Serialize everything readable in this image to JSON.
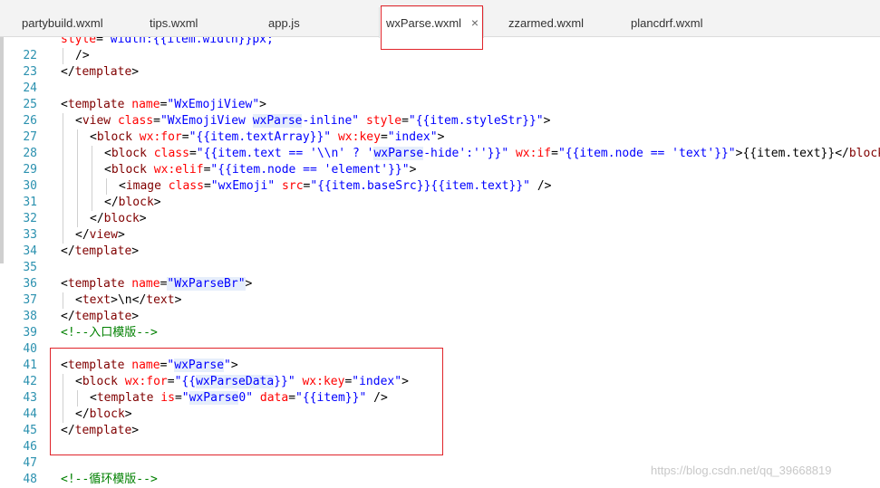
{
  "tabs": [
    {
      "label": "partybuild.wxml",
      "active": false
    },
    {
      "label": "tips.wxml",
      "active": false
    },
    {
      "label": "app.js",
      "active": false
    },
    {
      "label": "wxParse.wxml",
      "active": true,
      "close": "×"
    },
    {
      "label": "zzarmed.wxml",
      "active": false
    },
    {
      "label": "plancdrf.wxml",
      "active": false
    }
  ],
  "colors": {
    "highlight_box": "#e0242a",
    "line_number": "#2b91af",
    "tag": "#800000",
    "attribute": "#ff0000",
    "string": "#0000ff",
    "comment": "#008000"
  },
  "lines": [
    {
      "n": "",
      "indent": 0,
      "tokens": [
        [
          "attr",
          "style"
        ],
        [
          "br",
          "="
        ],
        [
          "str",
          "\"width:{{item.width}}px;\""
        ]
      ]
    },
    {
      "n": "22",
      "indent": 1,
      "tokens": [
        [
          "br",
          "/>"
        ]
      ]
    },
    {
      "n": "23",
      "indent": 0,
      "tokens": [
        [
          "br",
          "</"
        ],
        [
          "tag",
          "template"
        ],
        [
          "br",
          ">"
        ]
      ]
    },
    {
      "n": "24",
      "indent": 0,
      "tokens": []
    },
    {
      "n": "25",
      "indent": 0,
      "tokens": [
        [
          "br",
          "<"
        ],
        [
          "tag",
          "template"
        ],
        [
          "txt",
          " "
        ],
        [
          "attr",
          "name"
        ],
        [
          "br",
          "="
        ],
        [
          "str",
          "\"WxEmojiView\""
        ],
        [
          "br",
          ">"
        ]
      ]
    },
    {
      "n": "26",
      "indent": 1,
      "tokens": [
        [
          "br",
          "<"
        ],
        [
          "tag",
          "view"
        ],
        [
          "txt",
          " "
        ],
        [
          "attr",
          "class"
        ],
        [
          "br",
          "="
        ],
        [
          "str",
          "\"WxEmojiView "
        ],
        [
          "strhl",
          "wxParse"
        ],
        [
          "str",
          "-inline\""
        ],
        [
          "txt",
          " "
        ],
        [
          "attr",
          "style"
        ],
        [
          "br",
          "="
        ],
        [
          "str",
          "\"{{item.styleStr}}\""
        ],
        [
          "br",
          ">"
        ]
      ]
    },
    {
      "n": "27",
      "indent": 2,
      "tokens": [
        [
          "br",
          "<"
        ],
        [
          "tag",
          "block"
        ],
        [
          "txt",
          " "
        ],
        [
          "attr",
          "wx:for"
        ],
        [
          "br",
          "="
        ],
        [
          "str",
          "\"{{item.textArray}}\""
        ],
        [
          "txt",
          " "
        ],
        [
          "attr",
          "wx:key"
        ],
        [
          "br",
          "="
        ],
        [
          "str",
          "\"index\""
        ],
        [
          "br",
          ">"
        ]
      ]
    },
    {
      "n": "28",
      "indent": 3,
      "tokens": [
        [
          "br",
          "<"
        ],
        [
          "tag",
          "block"
        ],
        [
          "txt",
          " "
        ],
        [
          "attr",
          "class"
        ],
        [
          "br",
          "="
        ],
        [
          "str",
          "\"{{item.text == '\\\\n' ? '"
        ],
        [
          "strhl",
          "wxParse"
        ],
        [
          "str",
          "-hide':''}}\""
        ],
        [
          "txt",
          " "
        ],
        [
          "attr",
          "wx:if"
        ],
        [
          "br",
          "="
        ],
        [
          "str",
          "\"{{item.node == 'text'}}\""
        ],
        [
          "br",
          ">"
        ],
        [
          "txt",
          "{{item.text}}"
        ],
        [
          "br",
          "</"
        ],
        [
          "tag",
          "block"
        ],
        [
          "br",
          ">"
        ]
      ]
    },
    {
      "n": "29",
      "indent": 3,
      "tokens": [
        [
          "br",
          "<"
        ],
        [
          "tag",
          "block"
        ],
        [
          "txt",
          " "
        ],
        [
          "attr",
          "wx:elif"
        ],
        [
          "br",
          "="
        ],
        [
          "str",
          "\"{{item.node == 'element'}}\""
        ],
        [
          "br",
          ">"
        ]
      ]
    },
    {
      "n": "30",
      "indent": 4,
      "tokens": [
        [
          "br",
          "<"
        ],
        [
          "tag",
          "image"
        ],
        [
          "txt",
          " "
        ],
        [
          "attr",
          "class"
        ],
        [
          "br",
          "="
        ],
        [
          "str",
          "\"wxEmoji\""
        ],
        [
          "txt",
          " "
        ],
        [
          "attr",
          "src"
        ],
        [
          "br",
          "="
        ],
        [
          "str",
          "\"{{item.baseSrc}}{{item.text}}\""
        ],
        [
          "txt",
          " "
        ],
        [
          "br",
          "/>"
        ]
      ]
    },
    {
      "n": "31",
      "indent": 3,
      "tokens": [
        [
          "br",
          "</"
        ],
        [
          "tag",
          "block"
        ],
        [
          "br",
          ">"
        ]
      ]
    },
    {
      "n": "32",
      "indent": 2,
      "tokens": [
        [
          "br",
          "</"
        ],
        [
          "tag",
          "block"
        ],
        [
          "br",
          ">"
        ]
      ]
    },
    {
      "n": "33",
      "indent": 1,
      "tokens": [
        [
          "br",
          "</"
        ],
        [
          "tag",
          "view"
        ],
        [
          "br",
          ">"
        ]
      ]
    },
    {
      "n": "34",
      "indent": 0,
      "tokens": [
        [
          "br",
          "</"
        ],
        [
          "tag",
          "template"
        ],
        [
          "br",
          ">"
        ]
      ]
    },
    {
      "n": "35",
      "indent": 0,
      "tokens": []
    },
    {
      "n": "36",
      "indent": 0,
      "tokens": [
        [
          "br",
          "<"
        ],
        [
          "tag",
          "template"
        ],
        [
          "txt",
          " "
        ],
        [
          "attr",
          "name"
        ],
        [
          "br",
          "="
        ],
        [
          "strhl",
          "\"WxParseBr\""
        ],
        [
          "br",
          ">"
        ]
      ]
    },
    {
      "n": "37",
      "indent": 1,
      "tokens": [
        [
          "br",
          "<"
        ],
        [
          "tag",
          "text"
        ],
        [
          "br",
          ">"
        ],
        [
          "txt",
          "\\n"
        ],
        [
          "br",
          "</"
        ],
        [
          "tag",
          "text"
        ],
        [
          "br",
          ">"
        ]
      ]
    },
    {
      "n": "38",
      "indent": 0,
      "tokens": [
        [
          "br",
          "</"
        ],
        [
          "tag",
          "template"
        ],
        [
          "br",
          ">"
        ]
      ]
    },
    {
      "n": "39",
      "indent": 0,
      "tokens": [
        [
          "cmt",
          "<!--入口模版-->"
        ]
      ]
    },
    {
      "n": "40",
      "indent": 0,
      "tokens": []
    },
    {
      "n": "41",
      "indent": 0,
      "tokens": [
        [
          "br",
          "<"
        ],
        [
          "tag",
          "template"
        ],
        [
          "txt",
          " "
        ],
        [
          "attr",
          "name"
        ],
        [
          "br",
          "="
        ],
        [
          "str",
          "\""
        ],
        [
          "strhl",
          "wxParse"
        ],
        [
          "str",
          "\""
        ],
        [
          "br",
          ">"
        ]
      ]
    },
    {
      "n": "42",
      "indent": 1,
      "tokens": [
        [
          "br",
          "<"
        ],
        [
          "tag",
          "block"
        ],
        [
          "txt",
          " "
        ],
        [
          "attr",
          "wx:for"
        ],
        [
          "br",
          "="
        ],
        [
          "str",
          "\"{{"
        ],
        [
          "strhl",
          "wxParseData"
        ],
        [
          "str",
          "}}\""
        ],
        [
          "txt",
          " "
        ],
        [
          "attr",
          "wx:key"
        ],
        [
          "br",
          "="
        ],
        [
          "str",
          "\"index\""
        ],
        [
          "br",
          ">"
        ]
      ]
    },
    {
      "n": "43",
      "indent": 2,
      "tokens": [
        [
          "br",
          "<"
        ],
        [
          "tag",
          "template"
        ],
        [
          "txt",
          " "
        ],
        [
          "attr",
          "is"
        ],
        [
          "br",
          "="
        ],
        [
          "str",
          "\""
        ],
        [
          "strhl",
          "wxParse"
        ],
        [
          "str",
          "0\""
        ],
        [
          "txt",
          " "
        ],
        [
          "attr",
          "data"
        ],
        [
          "br",
          "="
        ],
        [
          "str",
          "\"{{item}}\""
        ],
        [
          "txt",
          " "
        ],
        [
          "br",
          "/>"
        ]
      ]
    },
    {
      "n": "44",
      "indent": 1,
      "tokens": [
        [
          "br",
          "</"
        ],
        [
          "tag",
          "block"
        ],
        [
          "br",
          ">"
        ]
      ]
    },
    {
      "n": "45",
      "indent": 0,
      "tokens": [
        [
          "br",
          "</"
        ],
        [
          "tag",
          "template"
        ],
        [
          "br",
          ">"
        ]
      ]
    },
    {
      "n": "46",
      "indent": 0,
      "tokens": []
    },
    {
      "n": "47",
      "indent": 0,
      "tokens": []
    },
    {
      "n": "48",
      "indent": 0,
      "tokens": [
        [
          "cmt",
          "<!--循环模版-->"
        ]
      ]
    }
  ],
  "watermark": "https://blog.csdn.net/qq_39668819"
}
